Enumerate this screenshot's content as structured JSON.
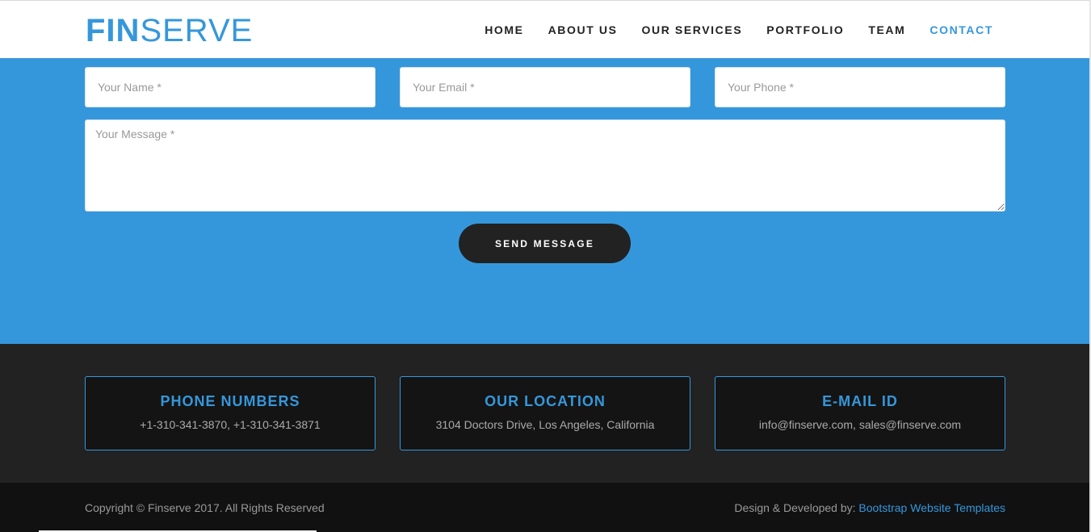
{
  "brand": {
    "logo_bold": "FIN",
    "logo_light": "SERVE"
  },
  "nav": {
    "items": [
      {
        "label": "HOME"
      },
      {
        "label": "ABOUT US"
      },
      {
        "label": "OUR SERVICES"
      },
      {
        "label": "PORTFOLIO"
      },
      {
        "label": "TEAM"
      },
      {
        "label": "CONTACT",
        "active": true
      }
    ]
  },
  "form": {
    "name_placeholder": "Your Name *",
    "email_placeholder": "Your Email *",
    "phone_placeholder": "Your Phone *",
    "message_placeholder": "Your Message *",
    "send_label": "SEND MESSAGE"
  },
  "info": {
    "phone": {
      "title": "PHONE NUMBERS",
      "text": "+1-310-341-3870, +1-310-341-3871"
    },
    "location": {
      "title": "OUR LOCATION",
      "text": "3104 Doctors Drive, Los Angeles, California"
    },
    "email": {
      "title": "E-MAIL ID",
      "text": "info@finserve.com, sales@finserve.com"
    }
  },
  "footer": {
    "copyright": "Copyright © Finserve 2017. All Rights Reserved",
    "credit_prefix": "Design & Developed by:",
    "credit_link": "Bootstrap Website Templates"
  },
  "colors": {
    "accent": "#3597db",
    "dark": "#222222",
    "darker": "#111111"
  }
}
